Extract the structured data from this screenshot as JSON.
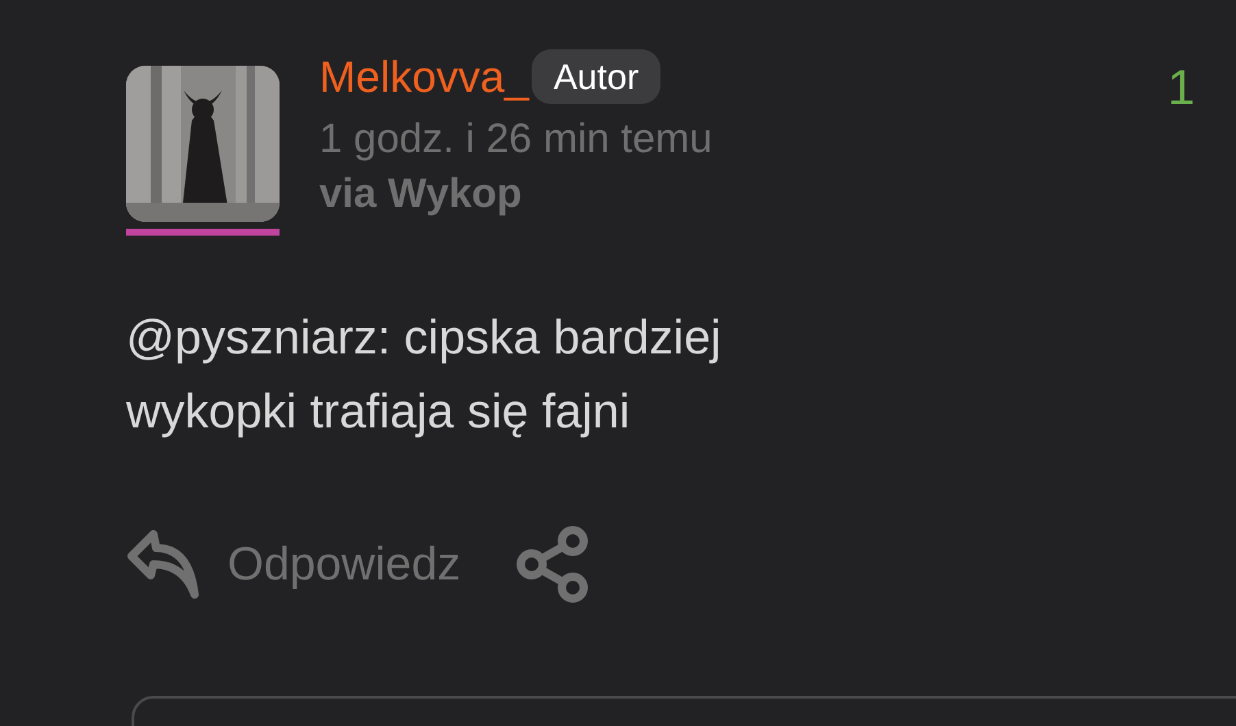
{
  "author": {
    "name": "Melkovva_",
    "badge": "Autor",
    "time": "1 godz. i 26 min temu",
    "source": "via Wykop",
    "color": "#c0449e"
  },
  "score": "1",
  "body": "@pyszniarz: cipska bardziej wykopki trafiaja się fajni",
  "actions": {
    "reply": "Odpowiedz"
  }
}
